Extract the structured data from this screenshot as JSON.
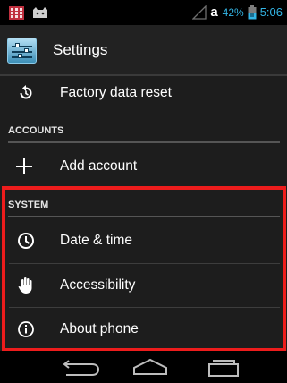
{
  "status_bar": {
    "battery_percent": "42%",
    "carrier_glyph": "a",
    "time": "5:06",
    "icons": [
      "calendar-icon",
      "cat-notification-icon",
      "signal-icon",
      "sim-icon"
    ]
  },
  "action_bar": {
    "title": "Settings",
    "icon": "settings-app-icon"
  },
  "list": {
    "factory_reset": {
      "label": "Factory data reset",
      "icon": "factory-reset-icon"
    },
    "accounts_header": "ACCOUNTS",
    "add_account": {
      "label": "Add account",
      "icon": "plus-icon"
    },
    "system_header": "SYSTEM",
    "date_time": {
      "label": "Date & time",
      "icon": "clock-icon"
    },
    "accessibility": {
      "label": "Accessibility",
      "icon": "hand-icon"
    },
    "about_phone": {
      "label": "About phone",
      "icon": "info-icon"
    }
  },
  "nav_bar": {
    "buttons": [
      "back-icon",
      "home-icon",
      "recents-icon"
    ]
  },
  "colors": {
    "accent": "#33b5e5",
    "highlight": "#ed1c1c",
    "background": "#1d1d1d"
  }
}
